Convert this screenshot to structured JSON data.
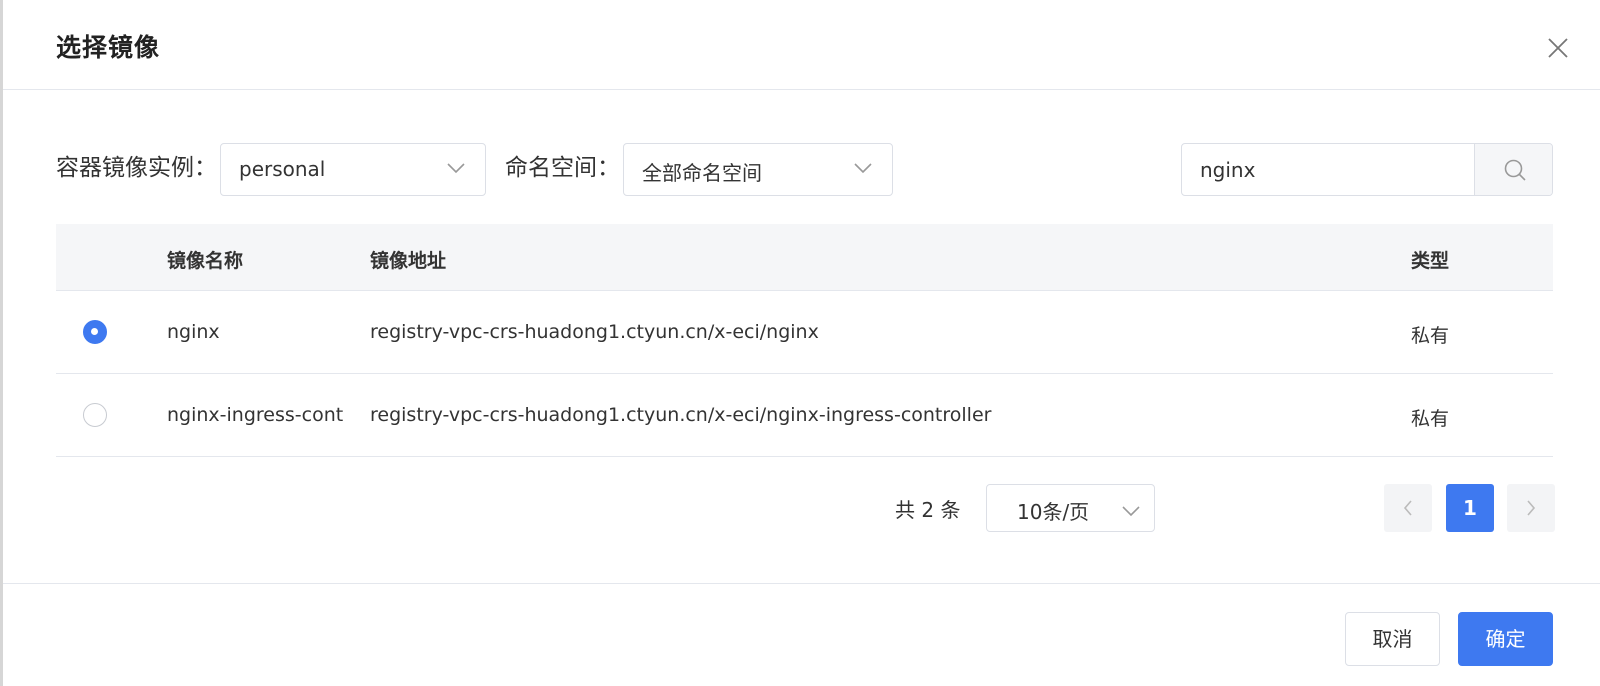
{
  "dialog": {
    "title": "选择镜像"
  },
  "filters": {
    "instance_label": "容器镜像实例：",
    "instance_value": "personal",
    "namespace_label": "命名空间：",
    "namespace_value": "全部命名空间",
    "search_value": "nginx"
  },
  "table": {
    "headers": {
      "name": "镜像名称",
      "address": "镜像地址",
      "type": "类型"
    },
    "rows": [
      {
        "selected": true,
        "name": "nginx",
        "address": "registry-vpc-crs-huadong1.ctyun.cn/x-eci/nginx",
        "type": "私有"
      },
      {
        "selected": false,
        "name": "nginx-ingress-controller",
        "address": "registry-vpc-crs-huadong1.ctyun.cn/x-eci/nginx-ingress-controller",
        "type": "私有"
      }
    ]
  },
  "pagination": {
    "total_text": "共 2 条",
    "page_size": "10条/页",
    "current_page": "1"
  },
  "footer": {
    "cancel_label": "取消",
    "confirm_label": "确定"
  },
  "colors": {
    "primary": "#3e79f0",
    "border": "#dcdfe6",
    "header_bg": "#f5f6f8"
  },
  "icons": {
    "close": "close-icon",
    "chevron": "chevron-down-icon",
    "search": "search-icon",
    "prev": "chevron-left-icon",
    "next": "chevron-right-icon"
  }
}
